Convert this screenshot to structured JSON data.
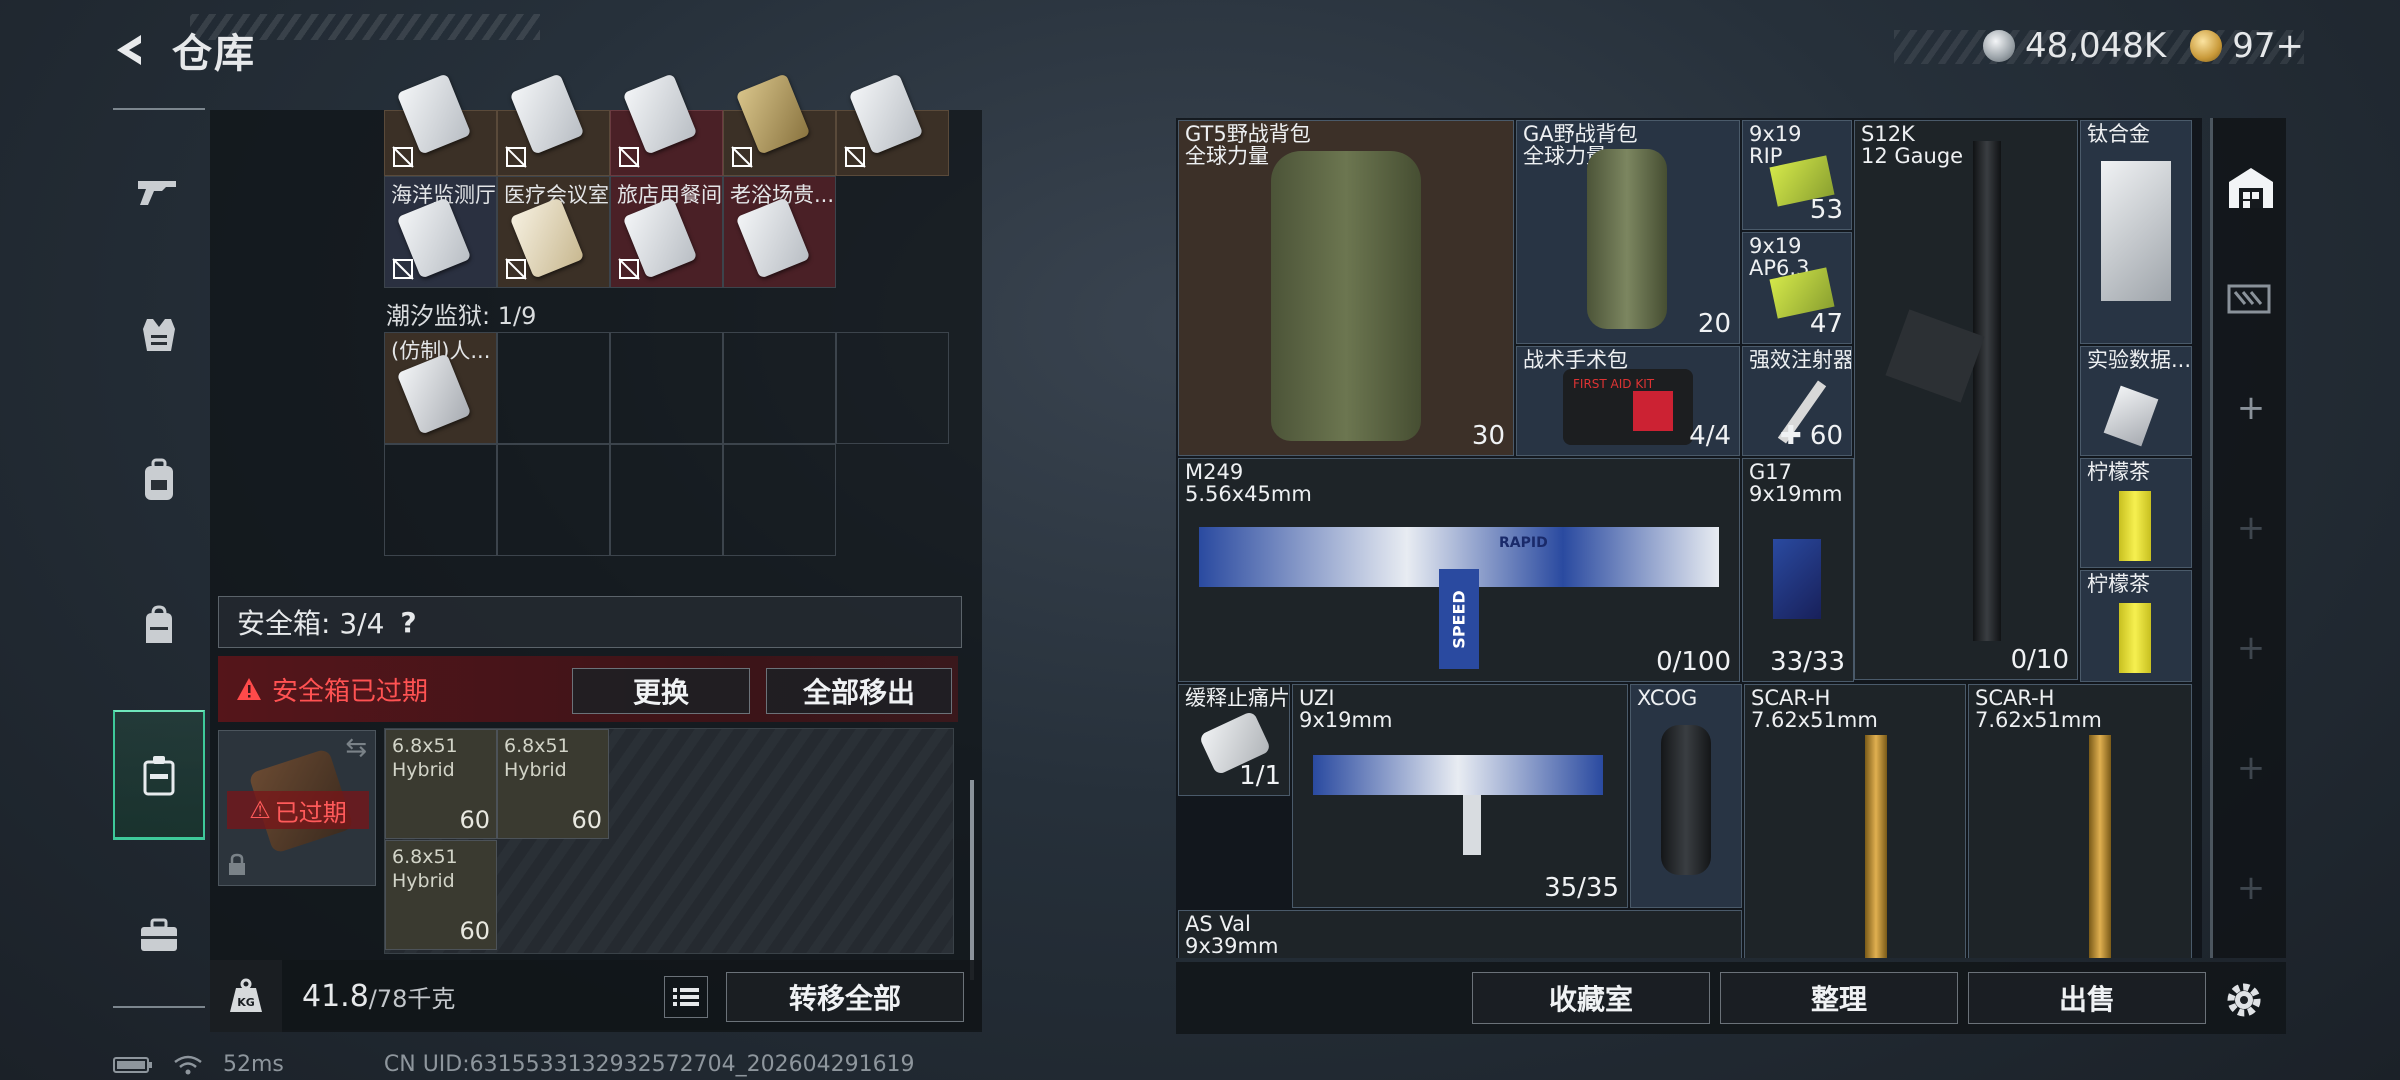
{
  "header": {
    "title": "仓库",
    "currency1": "48,048K",
    "currency2": "97+"
  },
  "sidebar": {
    "items": [
      {
        "name": "weapons",
        "icon": "gun-icon"
      },
      {
        "name": "armor",
        "icon": "vest-icon"
      },
      {
        "name": "backpack",
        "icon": "backpack-icon"
      },
      {
        "name": "bag",
        "icon": "bag-icon"
      },
      {
        "name": "safebox",
        "icon": "safebox-icon"
      },
      {
        "name": "toolbox",
        "icon": "toolbox-icon"
      }
    ]
  },
  "left_panel": {
    "keycards_top": [
      "",
      "",
      "",
      "",
      ""
    ],
    "keycards_row2": [
      "海洋监测厅",
      "医疗会议室",
      "旅店用餐间",
      "老浴场贵..."
    ],
    "section_prison": "潮汐监狱: 1/9",
    "prison_card": "(仿制)人...",
    "safebox_label": "安全箱: 3/4",
    "safebox_help": "?",
    "expired_warning": "安全箱已过期",
    "replace_button": "更换",
    "remove_all_button": "全部移出",
    "expired_badge": "已过期",
    "ammo": [
      {
        "name": "6.8x51\nHybrid",
        "count": "60"
      },
      {
        "name": "6.8x51\nHybrid",
        "count": "60"
      },
      {
        "name": "6.8x51\nHybrid",
        "count": "60"
      }
    ],
    "weight_value": "41.8",
    "weight_max": "/78千克",
    "weight_icon_text": "KG",
    "transfer_all_button": "转移全部"
  },
  "right_panel": {
    "items": [
      {
        "name": "GT5野战背包\n全球力量",
        "count": "30"
      },
      {
        "name": "GA野战背包\n全球力量",
        "count": "20"
      },
      {
        "name": "9x19\nRIP",
        "count": "53"
      },
      {
        "name": "9x19\nAP6.3",
        "count": "47"
      },
      {
        "name": "S12K\n12 Gauge",
        "count": "0/10"
      },
      {
        "name": "钛合金",
        "count": ""
      },
      {
        "name": "战术手术包",
        "count": "4/4"
      },
      {
        "name": "强效注射器",
        "count": "60"
      },
      {
        "name": "实验数据...",
        "count": ""
      },
      {
        "name": "M249\n5.56x45mm",
        "count": "0/100"
      },
      {
        "name": "G17\n9x19mm",
        "count": "33/33"
      },
      {
        "name": "柠檬茶",
        "count": ""
      },
      {
        "name": "柠檬茶",
        "count": ""
      },
      {
        "name": "缓释止痛片",
        "count": "1/1"
      },
      {
        "name": "UZI\n9x19mm",
        "count": "35/35"
      },
      {
        "name": "XCOG",
        "count": ""
      },
      {
        "name": "SCAR-H\n7.62x51mm",
        "count": ""
      },
      {
        "name": "SCAR-H\n7.62x51mm",
        "count": ""
      },
      {
        "name": "AS Val\n9x39mm",
        "count": ""
      }
    ],
    "first_aid_text": "FIRST AID KIT",
    "m249_decal": "SPEED",
    "m249_tag": "RAPID",
    "collection_button": "收藏室",
    "organize_button": "整理",
    "sell_button": "出售"
  },
  "status_bar": {
    "ping": "52ms",
    "uid": "CN UID:6315533132932572704_202604291619"
  }
}
